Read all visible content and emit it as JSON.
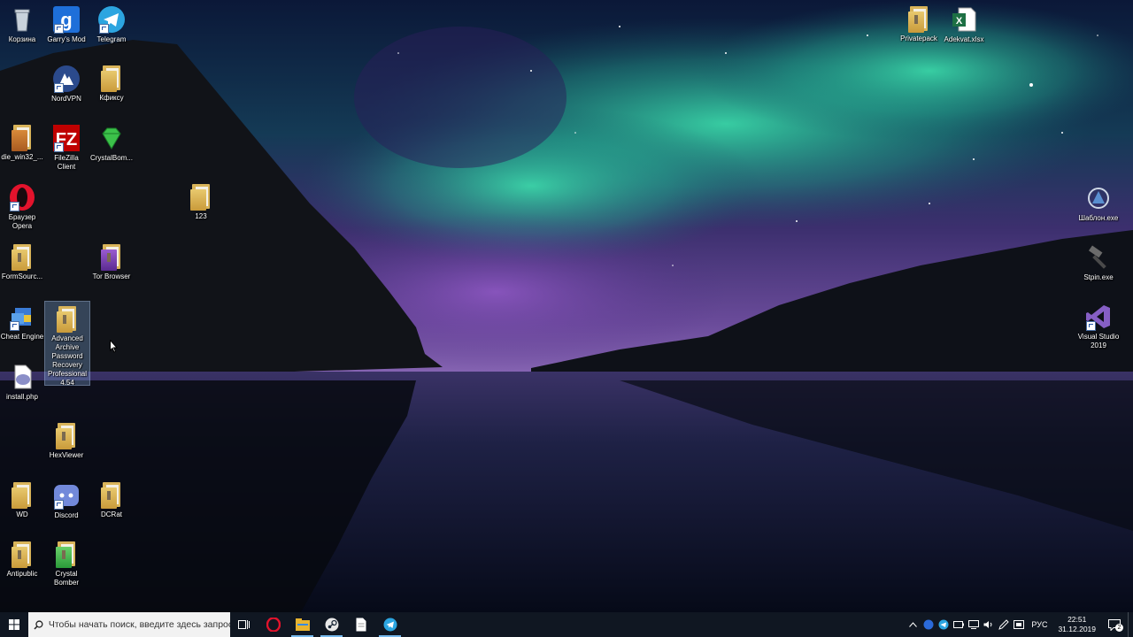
{
  "desktop": {
    "icons": {
      "recycle": "Корзина",
      "gmod": "Garry's Mod",
      "telegram": "Telegram",
      "nordvpn": "NordVPN",
      "kfiksu": "Кфиксу",
      "die": "die_win32_...",
      "filezilla": "FileZilla Client",
      "crystalbom": "CrystalBom...",
      "opera": "Браузер Opera",
      "f123": "123",
      "formsource": "FormSourc...",
      "torbrowser": "Tor Browser",
      "cheatengine": "Cheat Engine",
      "aapr": "Advanced Archive Password Recovery Professional 4.54",
      "installphp": "install.php",
      "hexviewer": "HexViewer",
      "wd": "WD",
      "discord": "Discord",
      "dcrat": "DCRat",
      "antipublic": "Antipublic",
      "crystalbomber": "Crystal Bomber",
      "privatepack": "Privatepack",
      "adekvat": "Adekvat.xlsx",
      "shablon": "Шаблон.exe",
      "stpin": "Stpin.exe",
      "vs2019": "Visual Studio 2019"
    }
  },
  "taskbar": {
    "search_placeholder": "Чтобы начать поиск, введите здесь запрос",
    "apps": [
      "task-view",
      "opera",
      "file-explorer",
      "steam",
      "notepad",
      "telegram"
    ],
    "tray": {
      "language": "РУС",
      "time": "22:51",
      "date": "31.12.2019",
      "notification_count": "2"
    }
  },
  "colors": {
    "taskbar_bg": "#101722",
    "search_bg": "#f2f2f2",
    "aurora_green": "#2fd0a0",
    "aurora_purple": "#7a4fb8"
  }
}
